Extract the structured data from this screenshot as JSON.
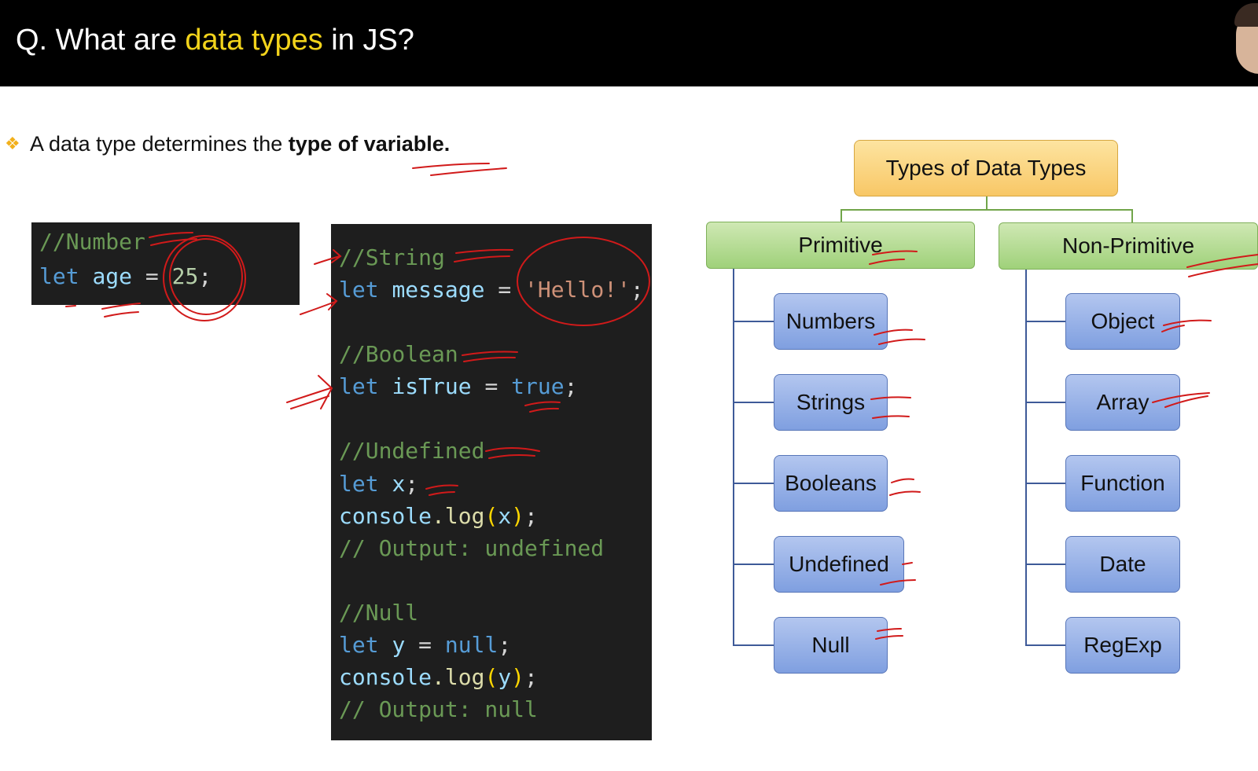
{
  "header": {
    "title_prefix": "Q. What are ",
    "title_highlight": "data types",
    "title_suffix": " in JS?"
  },
  "bullet": {
    "text_prefix": "A data type determines the ",
    "text_bold": "type of variable."
  },
  "code_panel_a": {
    "comment": "//Number",
    "keyword": "let",
    "variable": "age",
    "operator": "=",
    "value": "25",
    "terminator": ";"
  },
  "code_panel_b": {
    "string_comment": "//String",
    "string_kw": "let",
    "string_var": "message",
    "string_op": "=",
    "string_value": "'Hello!'",
    "string_term": ";",
    "boolean_comment": "//Boolean",
    "boolean_kw": "let",
    "boolean_var": "isTrue",
    "boolean_op": "=",
    "boolean_value": "true",
    "boolean_term": ";",
    "undefined_comment": "//Undefined",
    "undefined_kw": "let",
    "undefined_var": "x",
    "undefined_term": ";",
    "log_x_obj": "console",
    "log_x_fn": ".log",
    "log_x_arg": "x",
    "log_x_output": "// Output: undefined",
    "null_comment": "//Null",
    "null_kw": "let",
    "null_var": "y",
    "null_op": "=",
    "null_value": "null",
    "null_term": ";",
    "log_y_obj": "console",
    "log_y_fn": ".log",
    "log_y_arg": "y",
    "log_y_output": "// Output: null"
  },
  "diagram": {
    "root": "Types of Data Types",
    "primitive": {
      "label": "Primitive",
      "items": [
        "Numbers",
        "Strings",
        "Booleans",
        "Undefined",
        "Null"
      ]
    },
    "non_primitive": {
      "label": "Non-Primitive",
      "items": [
        "Object",
        "Array",
        "Function",
        "Date",
        "RegExp"
      ]
    }
  },
  "colors": {
    "header_bg": "#000000",
    "highlight": "#f2d31b",
    "root_fill": "#f8c766",
    "category_fill": "#9fd17a",
    "leaf_fill": "#7f9fe0",
    "annotation_ink": "#d11a1a"
  }
}
